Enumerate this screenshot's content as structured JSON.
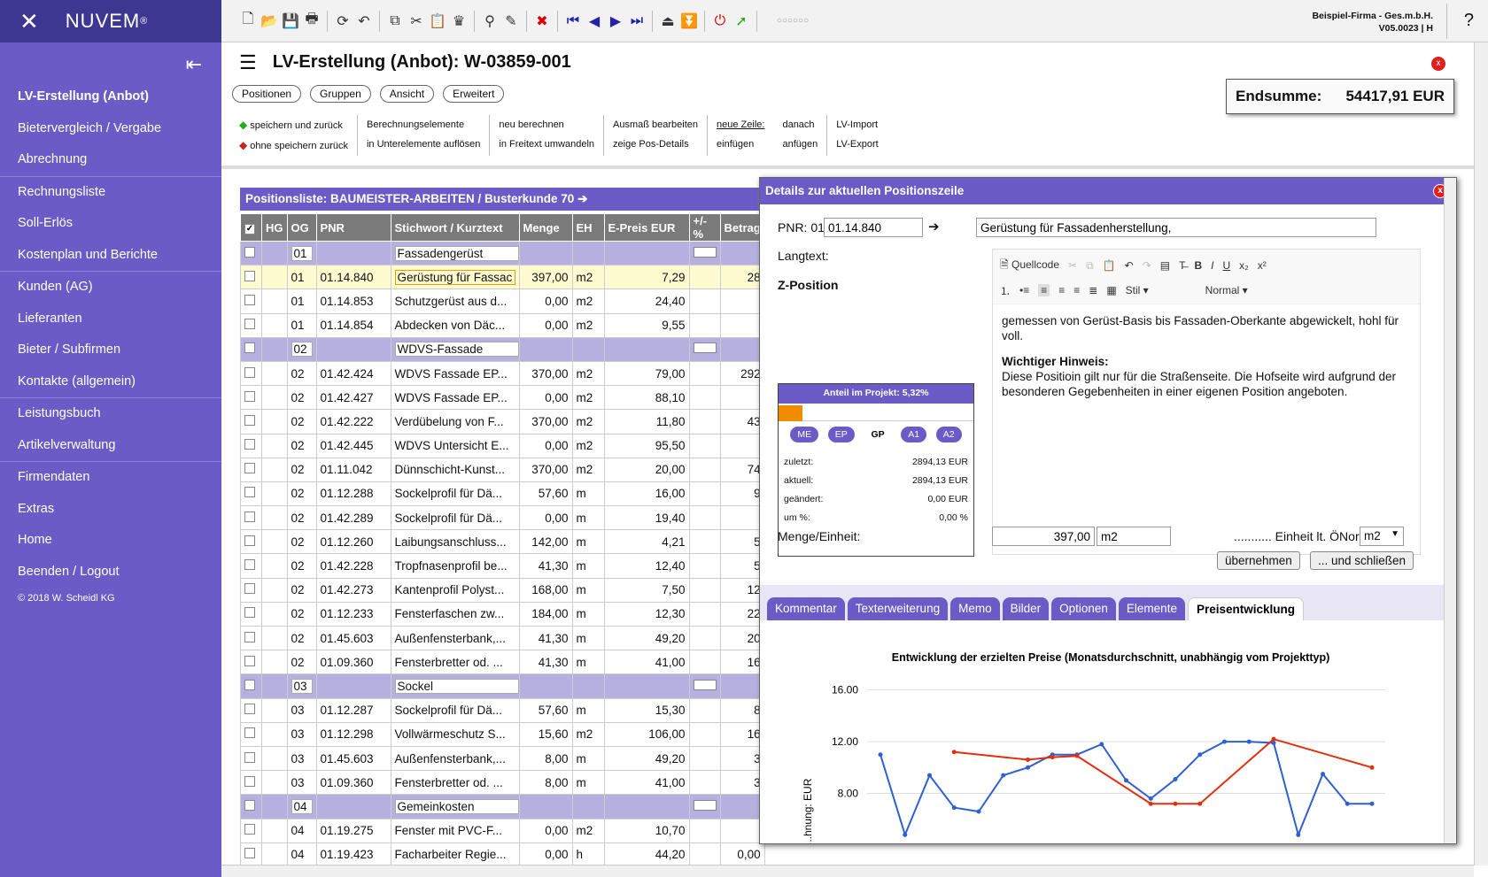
{
  "app": {
    "name": "NUVEM",
    "reg": "®"
  },
  "company": {
    "line1": "Beispiel-Firma - Ges.m.b.H.",
    "line2": "V05.0023 | H"
  },
  "help": "?",
  "nav": {
    "items": [
      "LV-Erstellung (Anbot)",
      "Bietervergleich / Vergabe",
      "Abrechnung",
      "Rechnungsliste",
      "Soll-Erlös",
      "Kostenplan und Berichte",
      "Kunden (AG)",
      "Lieferanten",
      "Bieter / Subfirmen",
      "Kontakte (allgemein)",
      "Leistungsbuch",
      "Artikelverwaltung",
      "Firmendaten",
      "Extras",
      "Home",
      "Beenden / Logout"
    ],
    "copyright": "© 2018 W. Scheidl KG"
  },
  "page_title": "LV-Erstellung (Anbot): W-03859-001",
  "endsumme": {
    "label": "Endsumme:",
    "value": "54417,91 EUR"
  },
  "tabs": [
    "Positionen",
    "Gruppen",
    "Ansicht",
    "Erweitert"
  ],
  "actions": {
    "save_back": "speichern und zurück",
    "nosave_back": "ohne speichern zurück",
    "calc1": "Berechnungselemente",
    "calc2": "in Unterelemente auflösen",
    "recalc1": "neu berechnen",
    "recalc2": "in Freitext umwandeln",
    "ausmass1": "Ausmaß bearbeiten",
    "ausmass2": "zeige Pos-Details",
    "newline1": "neue Zeile:",
    "newline2": "einfügen",
    "append1": "danach",
    "append2": "anfügen",
    "import": "LV-Import",
    "export": "LV-Export"
  },
  "list": {
    "title": "Positionsliste: BAUMEISTER-ARBEITEN / Busterkunde 70",
    "headers": [
      "",
      "HG",
      "OG",
      "PNR",
      "Stichwort / Kurztext",
      "Menge",
      "EH",
      "E-Preis EUR",
      "+/-%",
      "Betrag"
    ],
    "rows": [
      {
        "g": 1,
        "og": "01",
        "text": "Fassadengerüst"
      },
      {
        "sel": 1,
        "og": "01",
        "pnr": "01.14.840",
        "text": "Gerüstung für Fassac",
        "m": "397,00",
        "eh": "m2",
        "ep": "7,29",
        "b": "28"
      },
      {
        "og": "01",
        "pnr": "01.14.853",
        "text": "Schutzgerüst aus d...",
        "m": "0,00",
        "eh": "m2",
        "ep": "24,40",
        "b": ""
      },
      {
        "og": "01",
        "pnr": "01.14.854",
        "text": "Abdecken von Däc...",
        "m": "0,00",
        "eh": "m2",
        "ep": "9,55",
        "b": ""
      },
      {
        "g": 1,
        "og": "02",
        "text": "WDVS-Fassade"
      },
      {
        "og": "02",
        "pnr": "01.42.424",
        "text": "WDVS Fassade EP...",
        "m": "370,00",
        "eh": "m2",
        "ep": "79,00",
        "b": "292"
      },
      {
        "og": "02",
        "pnr": "01.42.427",
        "text": "WDVS Fassade EP...",
        "m": "0,00",
        "eh": "m2",
        "ep": "88,10",
        "b": ""
      },
      {
        "og": "02",
        "pnr": "01.42.222",
        "text": "Verdübelung von F...",
        "m": "370,00",
        "eh": "m2",
        "ep": "11,80",
        "b": "43"
      },
      {
        "og": "02",
        "pnr": "01.42.445",
        "text": "WDVS Untersicht E...",
        "m": "0,00",
        "eh": "m2",
        "ep": "95,50",
        "b": ""
      },
      {
        "og": "02",
        "pnr": "01.11.042",
        "text": "Dünnschicht-Kunst...",
        "m": "370,00",
        "eh": "m2",
        "ep": "20,00",
        "b": "74"
      },
      {
        "og": "02",
        "pnr": "01.12.288",
        "text": "Sockelprofil für Dä...",
        "m": "57,60",
        "eh": "m",
        "ep": "16,00",
        "b": "9"
      },
      {
        "og": "02",
        "pnr": "01.42.289",
        "text": "Sockelprofil für Dä...",
        "m": "0,00",
        "eh": "m",
        "ep": "19,40",
        "b": ""
      },
      {
        "og": "02",
        "pnr": "01.12.260",
        "text": "Laibungsanschluss...",
        "m": "142,00",
        "eh": "m",
        "ep": "4,21",
        "b": "5"
      },
      {
        "og": "02",
        "pnr": "01.42.228",
        "text": "Tropfnasenprofil be...",
        "m": "41,30",
        "eh": "m",
        "ep": "12,40",
        "b": "5"
      },
      {
        "og": "02",
        "pnr": "01.42.273",
        "text": "Kantenprofil Polyst...",
        "m": "168,00",
        "eh": "m",
        "ep": "7,50",
        "b": "12"
      },
      {
        "og": "02",
        "pnr": "01.12.233",
        "text": "Fensterfaschen zw...",
        "m": "184,00",
        "eh": "m",
        "ep": "12,30",
        "b": "22"
      },
      {
        "og": "02",
        "pnr": "01.45.603",
        "text": "Außenfensterbank,...",
        "m": "41,30",
        "eh": "m",
        "ep": "49,20",
        "b": "20"
      },
      {
        "og": "02",
        "pnr": "01.09.360",
        "text": "Fensterbretter od. ...",
        "m": "41,30",
        "eh": "m",
        "ep": "41,00",
        "b": "16"
      },
      {
        "g": 1,
        "og": "03",
        "text": "Sockel"
      },
      {
        "og": "03",
        "pnr": "01.12.287",
        "text": "Sockelprofil für Dä...",
        "m": "57,60",
        "eh": "m",
        "ep": "15,30",
        "b": "8"
      },
      {
        "og": "03",
        "pnr": "01.12.298",
        "text": "Vollwärmeschutz S...",
        "m": "15,60",
        "eh": "m2",
        "ep": "106,00",
        "b": "16"
      },
      {
        "og": "03",
        "pnr": "01.45.603",
        "text": "Außenfensterbank,...",
        "m": "8,00",
        "eh": "m",
        "ep": "49,20",
        "b": "3"
      },
      {
        "og": "03",
        "pnr": "01.09.360",
        "text": "Fensterbretter od. ...",
        "m": "8,00",
        "eh": "m",
        "ep": "41,00",
        "b": "3"
      },
      {
        "g": 1,
        "og": "04",
        "text": "Gemeinkosten"
      },
      {
        "og": "04",
        "pnr": "01.19.275",
        "text": "Fenster mit PVC-F...",
        "m": "0,00",
        "eh": "m2",
        "ep": "10,70",
        "b": ""
      },
      {
        "og": "04",
        "pnr": "01.19.423",
        "text": "Facharbeiter Regie...",
        "m": "0,00",
        "eh": "h",
        "ep": "44,20",
        "b": "0,00"
      }
    ]
  },
  "dialog": {
    "title": "Details zur aktuellen Positionszeile",
    "pnr_label": "PNR: 01",
    "pnr_value": "01.14.840",
    "short_text": "Gerüstung für Fassadenherstellung,",
    "langtext_label": "Langtext:",
    "zpos_label": "Z-Position",
    "editor_source": "Quellcode",
    "editor_style": "Stil",
    "editor_format": "Normal",
    "para1": "gemessen von Gerüst-Basis bis Fassaden-Oberkante abgewickelt, hohl für voll.",
    "para2_bold": "Wichtiger Hinweis:",
    "para2": "Diese Positioin gilt nur für die Straßenseite. Die Hofseite wird aufgrund der besonderen Gegebenheiten in einer eigenen Position angeboten.",
    "anteil": {
      "title": "Anteil im Projekt: 5,32%",
      "share": 5.32,
      "pills": [
        "ME",
        "EP",
        "GP",
        "A1",
        "A2"
      ],
      "rows": [
        [
          "zuletzt:",
          "2894,13 EUR"
        ],
        [
          "aktuell:",
          "2894,13 EUR"
        ],
        [
          "geändert:",
          "0,00 EUR"
        ],
        [
          "um %:",
          "0,00 %"
        ]
      ]
    },
    "menge_label": "Menge/Einheit:",
    "menge_value": "397,00",
    "einheit_value": "m2",
    "oenorm_label": "........... Einheit lt. ÖNorm:",
    "oenorm_value": "m2",
    "btn_apply": "übernehmen",
    "btn_apply_close": "... und schließen",
    "tabs": [
      "Kommentar",
      "Texterweiterung",
      "Memo",
      "Bilder",
      "Optionen",
      "Elemente",
      "Preisentwicklung"
    ]
  },
  "chart_data": {
    "type": "line",
    "title": "Entwicklung der erzielten Preise (Monatsdurchschnitt, unabhängig vom Projekttyp)",
    "ylabel": "...hnung: EUR",
    "yticks": [
      "16.00",
      "12.00",
      "8.00"
    ],
    "ylim": [
      4,
      17
    ],
    "series": [
      {
        "color": "#3060d0",
        "values": [
          11.0,
          4.8,
          9.4,
          6.9,
          6.6,
          9.4,
          10.0,
          11.0,
          11.0,
          11.8,
          9.0,
          7.6,
          9.1,
          11.0,
          12.0,
          12.0,
          11.9,
          4.8,
          9.5,
          7.2,
          7.2
        ]
      },
      {
        "color": "#e03010",
        "values": [
          null,
          null,
          null,
          11.2,
          null,
          null,
          10.6,
          10.8,
          10.9,
          null,
          null,
          7.2,
          7.2,
          7.2,
          null,
          null,
          12.2,
          null,
          null,
          null,
          10.0
        ]
      }
    ]
  }
}
